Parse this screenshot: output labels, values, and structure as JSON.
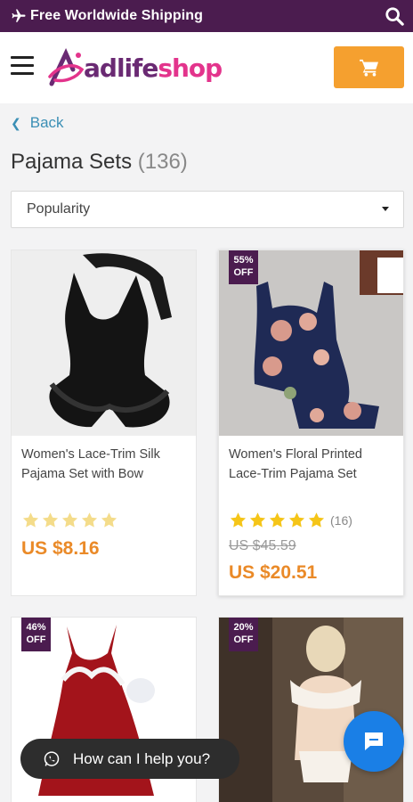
{
  "topbar": {
    "shipping_text": "Free Worldwide Shipping",
    "plane_icon": "plane-icon",
    "search_icon": "search-icon",
    "bg_color": "#4b1c4f"
  },
  "header": {
    "logo_text_part1": "adlife",
    "logo_text_part2": "shop",
    "menu_icon": "hamburger-icon",
    "cart_icon": "cart-icon",
    "cart_color": "#f5a02f"
  },
  "nav": {
    "back_label": "Back"
  },
  "category": {
    "title": "Pajama Sets",
    "count": "(136)"
  },
  "sort": {
    "selected": "Popularity"
  },
  "products": [
    {
      "name": "Women's Lace-Trim Silk Pajama Set with Bow",
      "rating": 0,
      "reviews": "",
      "old_price": "",
      "price": "US $8.16",
      "badge_pct": "",
      "badge_off": ""
    },
    {
      "name": "Women's Floral Printed Lace-Trim Pajama Set",
      "rating": 5,
      "reviews": "(16)",
      "old_price": "US $45.59",
      "price": "US $20.51",
      "badge_pct": "55%",
      "badge_off": "OFF"
    },
    {
      "name": "",
      "badge_pct": "46%",
      "badge_off": "OFF"
    },
    {
      "name": "",
      "badge_pct": "20%",
      "badge_off": "OFF"
    }
  ],
  "chat": {
    "prompt": "How can I help you?",
    "whatsapp_icon": "whatsapp-icon",
    "chat_icon": "chat-bubble-icon"
  },
  "colors": {
    "accent_orange": "#ea8a28",
    "link_blue": "#3b8fb5",
    "star_gold": "#f5c518",
    "star_empty": "#f4dc8a"
  }
}
